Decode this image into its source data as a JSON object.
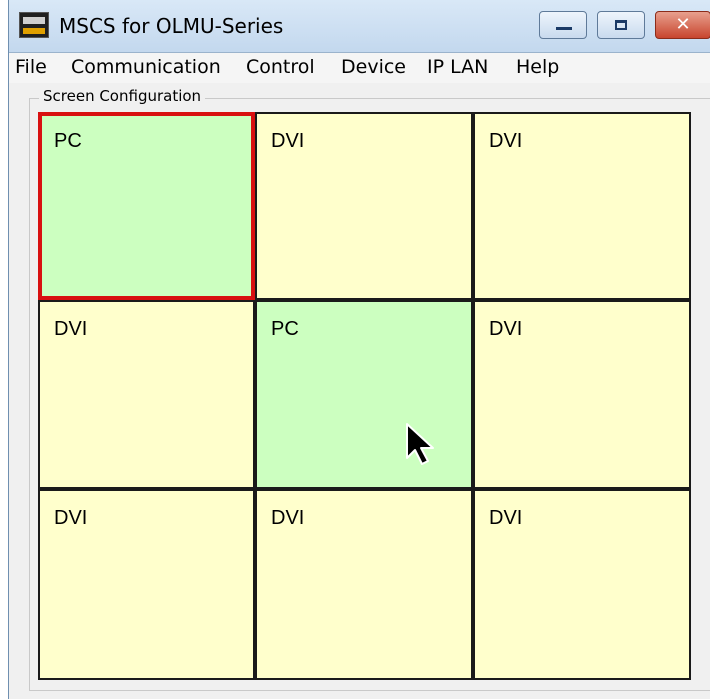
{
  "window": {
    "title": "MSCS for OLMU-Series"
  },
  "menu": [
    "File",
    "Communication",
    "Control",
    "Device",
    "IP LAN",
    "Help"
  ],
  "screen_config": {
    "label": "Screen Configuration",
    "cells": [
      {
        "label": "PC",
        "type": "pc",
        "selected": true
      },
      {
        "label": "DVI",
        "type": "dvi",
        "selected": false
      },
      {
        "label": "DVI",
        "type": "dvi",
        "selected": false
      },
      {
        "label": "DVI",
        "type": "dvi",
        "selected": false
      },
      {
        "label": "PC",
        "type": "pc",
        "selected": false
      },
      {
        "label": "DVI",
        "type": "dvi",
        "selected": false
      },
      {
        "label": "DVI",
        "type": "dvi",
        "selected": false
      },
      {
        "label": "DVI",
        "type": "dvi",
        "selected": false
      },
      {
        "label": "DVI",
        "type": "dvi",
        "selected": false
      }
    ]
  },
  "colors": {
    "pc_cell": "#ccffc0",
    "dvi_cell": "#ffffcc",
    "selected_border": "#d81010"
  }
}
